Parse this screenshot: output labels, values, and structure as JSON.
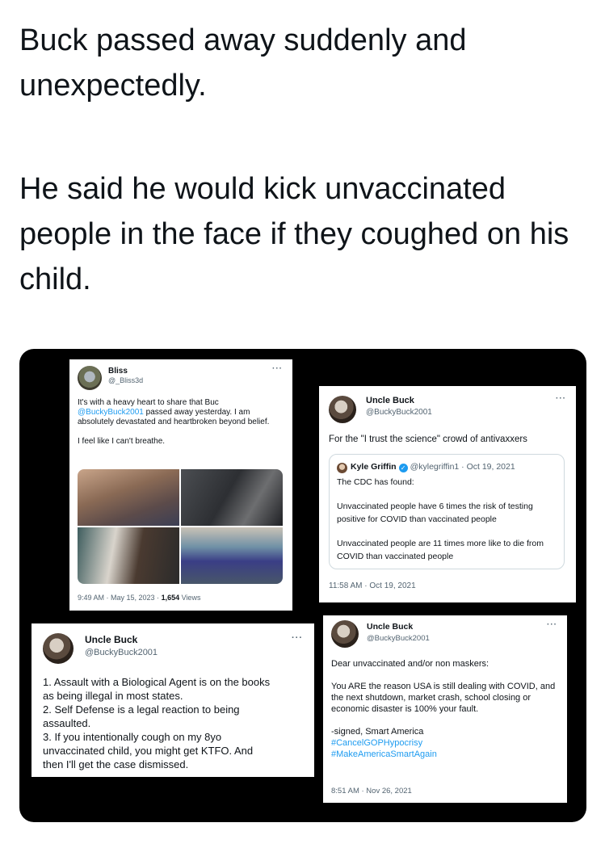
{
  "caption": {
    "line1": "Buck passed away suddenly and unexpectedly.",
    "line2": "He said he would kick unvaccinated people in the face if they coughed on his child."
  },
  "bliss_post": {
    "name": "Bliss",
    "handle": "@_Bliss3d",
    "text_before_link": "It's with a heavy heart to share that Buc ",
    "mention": "@BuckyBuck2001",
    "text_after_link": " passed away yesterday. I am absolutely devastated and heartbroken beyond belief.",
    "text2": "I feel like I can't breathe.",
    "timestamp": "9:49 AM · May 15, 2023 · ",
    "views_count": "1,654",
    "views_label": " Views"
  },
  "buck_post_1": {
    "name": "Uncle Buck",
    "handle": "@BuckyBuck2001",
    "text": "For the \"I trust the science\" crowd of antivaxxers",
    "quote": {
      "name": "Kyle Griffin",
      "handle_date": "@kylegriffin1 · Oct 19, 2021",
      "line1": "The CDC has found:",
      "line2": "Unvaccinated people have 6 times the risk of testing positive for COVID than vaccinated people",
      "line3": "Unvaccinated people are 11 times more like to die from COVID than vaccinated people"
    },
    "timestamp": "11:58 AM · Oct 19, 2021"
  },
  "buck_post_2": {
    "name": "Uncle Buck",
    "handle": "@BuckyBuck2001",
    "lines": [
      "1. Assault with a Biological Agent is on the books",
      "as being illegal in most states.",
      "2. Self Defense is a legal reaction to being",
      "assaulted.",
      "3. If you intentionally cough on my 8yo",
      "unvaccinated child, you might get KTFO. And",
      "then I'll get the case dismissed."
    ]
  },
  "buck_post_3": {
    "name": "Uncle Buck",
    "handle": "@BuckyBuck2001",
    "line1": "Dear unvaccinated and/or non maskers:",
    "line2": "You ARE the reason USA is still dealing with COVID, and the next shutdown, market crash, school closing or economic disaster is 100% your fault.",
    "line3": "-signed, Smart America",
    "hashtag1": "#CancelGOPHypocrisy",
    "hashtag2": "#MakeAmericaSmartAgain",
    "timestamp": "8:51 AM · Nov 26, 2021"
  },
  "ui": {
    "more_glyph": "···",
    "verified_glyph": "✓"
  },
  "colors": {
    "link": "#1d9bf0",
    "secondary_text": "#536471",
    "panel_background": "#000000",
    "card_background": "#ffffff"
  }
}
